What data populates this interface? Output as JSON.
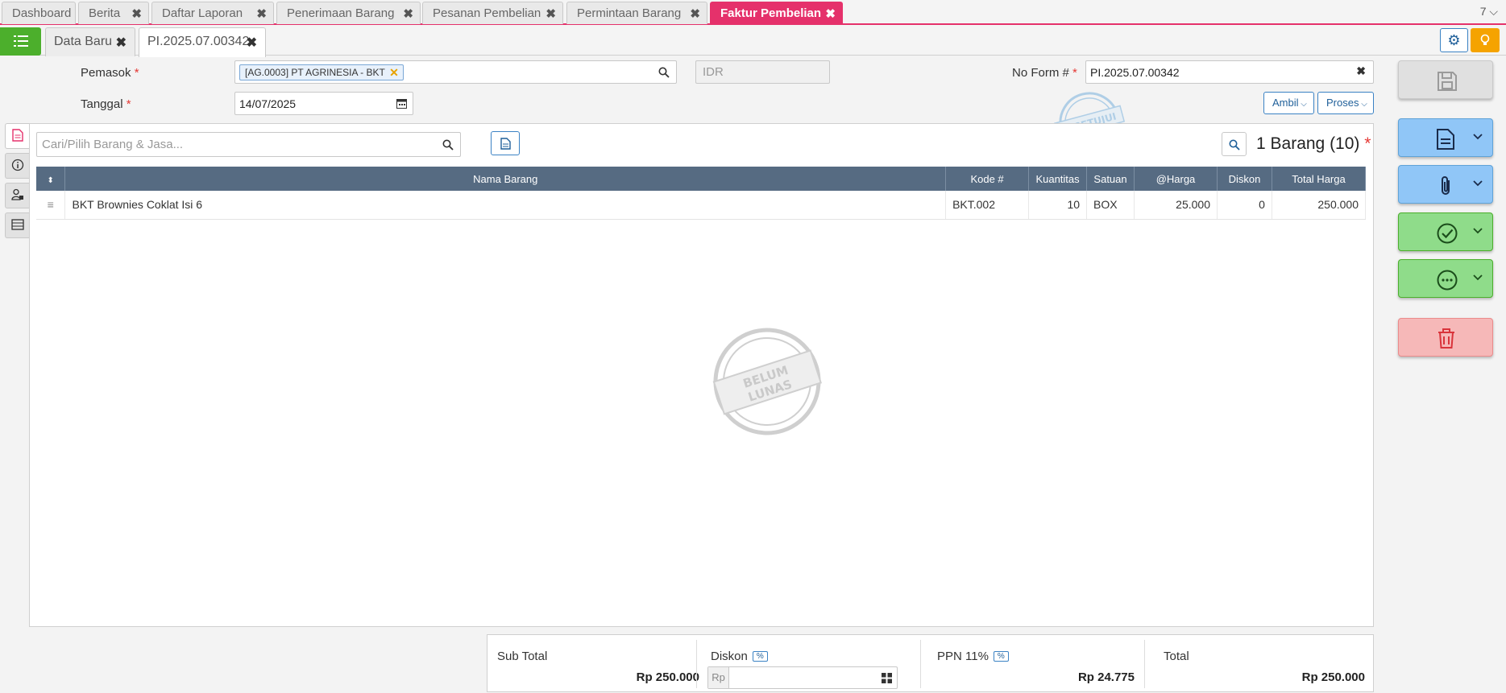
{
  "top_tabs": [
    {
      "label": "Dashboard"
    },
    {
      "label": "Berita"
    },
    {
      "label": "Daftar Laporan"
    },
    {
      "label": "Penerimaan Barang"
    },
    {
      "label": "Pesanan Pembelian"
    },
    {
      "label": "Permintaan Barang"
    },
    {
      "label": "Faktur Pembelian"
    }
  ],
  "top_tab_count": "7",
  "sub_tabs": [
    {
      "label": "Data Baru"
    },
    {
      "label": "PI.2025.07.00342"
    }
  ],
  "form": {
    "pemasok_label": "Pemasok",
    "pemasok_value": "[AG.0003] PT AGRINESIA - BKT",
    "currency_placeholder": "IDR",
    "no_form_label": "No Form #",
    "no_form_value": "PI.2025.07.00342",
    "tanggal_label": "Tanggal",
    "tanggal_value": "14/07/2025",
    "ambil_label": "Ambil",
    "proses_label": "Proses",
    "required_mark": "*"
  },
  "items_panel": {
    "search_placeholder": "Cari/Pilih Barang & Jasa...",
    "count_label": "1 Barang (10)",
    "columns": [
      "Nama Barang",
      "Kode #",
      "Kuantitas",
      "Satuan",
      "@Harga",
      "Diskon",
      "Total Harga"
    ],
    "rows": [
      {
        "name": "BKT Brownies Coklat Isi 6",
        "code": "BKT.002",
        "qty": "10",
        "unit": "BOX",
        "price": "25.000",
        "discount": "0",
        "total": "250.000"
      }
    ]
  },
  "stamps": {
    "approved": "DISETUJUI",
    "unpaid_line1": "BELUM",
    "unpaid_line2": "LUNAS"
  },
  "totals": {
    "subtotal_label": "Sub Total",
    "subtotal_value": "Rp 250.000",
    "discount_label": "Diskon",
    "discount_prefix": "Rp",
    "pct_badge": "%",
    "ppn_label": "PPN 11%",
    "ppn_value": "Rp 24.775",
    "total_label": "Total",
    "total_value": "Rp 250.000"
  },
  "colors": {
    "active_tab": "#e5316b",
    "header_row": "#566b82",
    "save": "#e0e0e0",
    "blue_action": "#90c6f7",
    "green_action": "#8fdc8a",
    "delete": "#f6b8b8"
  }
}
